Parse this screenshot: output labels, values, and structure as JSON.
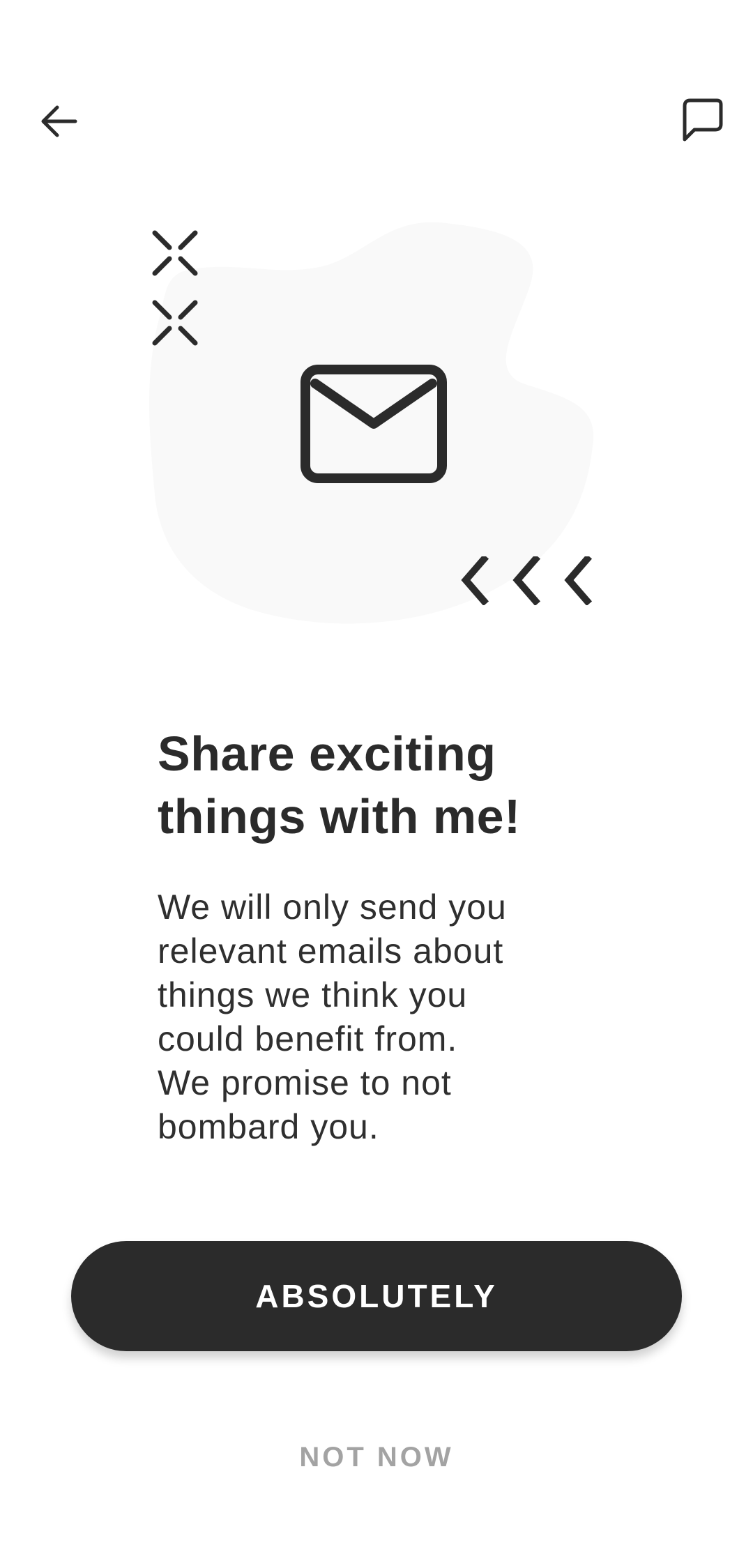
{
  "top_bar": {
    "back_icon": "arrow-left-icon",
    "chat_icon": "chat-bubble-icon"
  },
  "illustration": {
    "main_icon": "envelope-icon",
    "decorations": [
      "x-mark-icon",
      "x-mark-icon",
      "chevron-left-icon",
      "chevron-left-icon",
      "chevron-left-icon"
    ],
    "blob_color": "#f9f9f9",
    "icon_color": "#2b2b2b"
  },
  "content": {
    "headline_line1": "Share exciting",
    "headline_line2": "things with me!",
    "body_lines": [
      "We will only send you",
      "relevant emails about",
      "things we think you",
      "could benefit from.",
      "We promise to not",
      "bombard you."
    ]
  },
  "actions": {
    "primary_label": "ABSOLUTELY",
    "secondary_label": "NOT NOW"
  },
  "colors": {
    "primary": "#2b2b2b",
    "secondary_text": "#a3a3a3",
    "background": "#ffffff"
  }
}
